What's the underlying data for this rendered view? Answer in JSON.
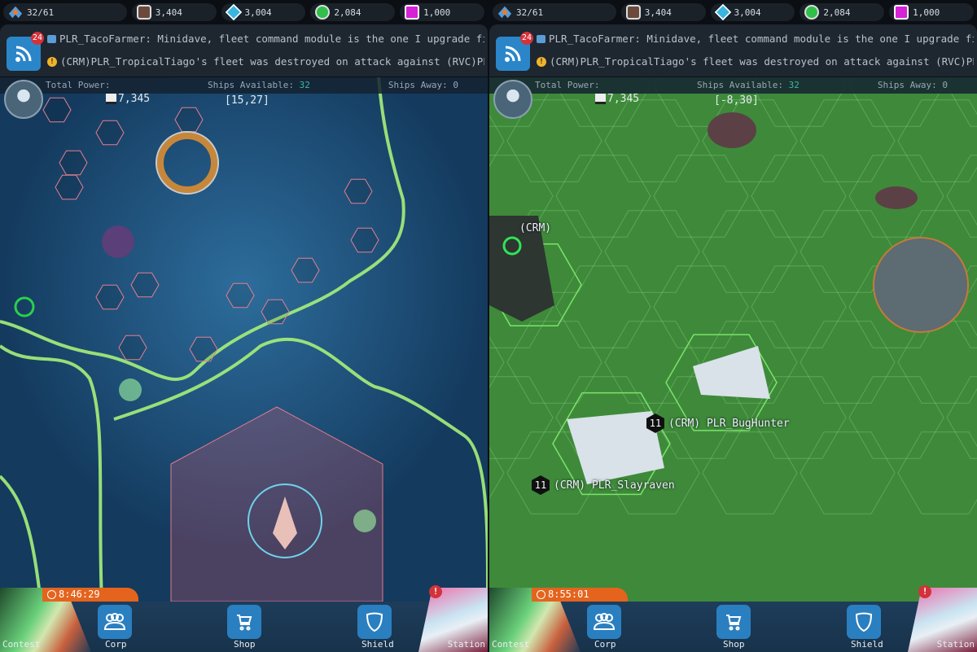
{
  "colors": {
    "accent": "#2a86c9",
    "timer": "#e4641d",
    "alert": "#d3323a",
    "ships_available": "#3fb6a0",
    "border_glow": "#a6f07a"
  },
  "panels": [
    {
      "resources": {
        "fleet": "32/61",
        "ore": "3,404",
        "crystal": "3,004",
        "gas": "2,084",
        "premium": "1,000"
      },
      "chat": {
        "badge": "24",
        "message1": "PLR_TacoFarmer: Minidave, fleet command module is the one I upgrade first ...",
        "message2": "(CRM)PLR_TropicalTiago's fleet was destroyed on attack against (RVC)PLR_Cr..."
      },
      "stats": {
        "total_power_label": "Total Power:",
        "total_power": "7,345",
        "ships_available_label": "Ships Available:",
        "ships_available": "32",
        "ships_away_label": "Ships Away:",
        "ships_away": "0",
        "coords": "[15,27]"
      },
      "map_theme": "blue",
      "timer": "8:46:29",
      "nav": {
        "contest": "Contest",
        "corp": "Corp",
        "shop": "Shop",
        "shield": "Shield",
        "station": "Station",
        "station_alert": "!"
      }
    },
    {
      "resources": {
        "fleet": "32/61",
        "ore": "3,404",
        "crystal": "3,004",
        "gas": "2,084",
        "premium": "1,000"
      },
      "chat": {
        "badge": "24",
        "message1": "PLR_TacoFarmer: Minidave, fleet command module is the one I upgrade first ...",
        "message2": "(CRM)PLR_TropicalTiago's fleet was destroyed on attack against (RVC)PLR_Cr..."
      },
      "stats": {
        "total_power_label": "Total Power:",
        "total_power": "7,345",
        "ships_available_label": "Ships Available:",
        "ships_available": "32",
        "ships_away_label": "Ships Away:",
        "ships_away": "0",
        "coords": "[-8,30]"
      },
      "map_theme": "green",
      "timer": "8:55:01",
      "nav": {
        "contest": "Contest",
        "corp": "Corp",
        "shop": "Shop",
        "shield": "Shield",
        "station": "Station",
        "station_alert": "!"
      },
      "map_labels": {
        "base_tag": "(CRM)",
        "fleet1_level": "11",
        "fleet1": "(CRM)  PLR_BugHunter",
        "fleet2_level": "11",
        "fleet2": "(CRM)  PLR_Slayraven"
      }
    }
  ]
}
